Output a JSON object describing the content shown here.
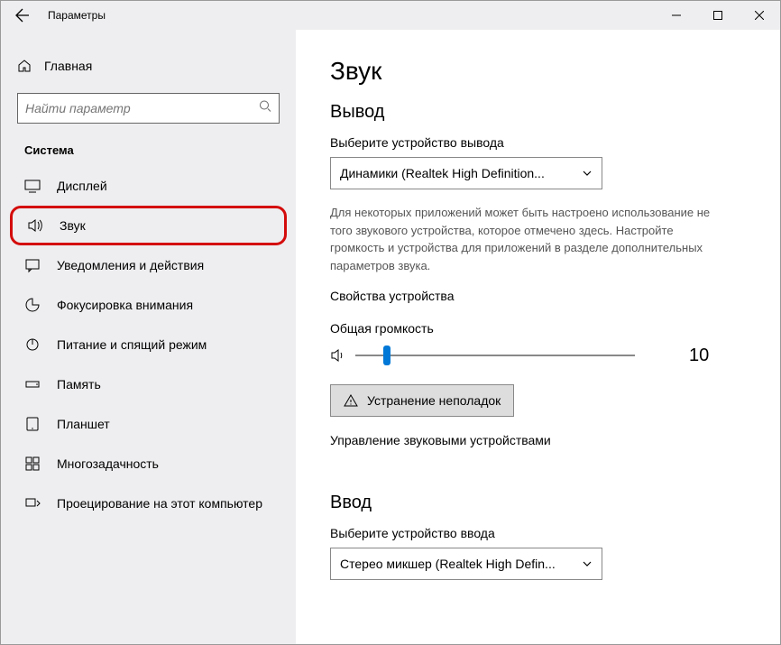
{
  "titlebar": {
    "title": "Параметры"
  },
  "sidebar": {
    "home": "Главная",
    "search_placeholder": "Найти параметр",
    "section": "Система",
    "items": [
      {
        "label": "Дисплей"
      },
      {
        "label": "Звук"
      },
      {
        "label": "Уведомления и действия"
      },
      {
        "label": "Фокусировка внимания"
      },
      {
        "label": "Питание и спящий режим"
      },
      {
        "label": "Память"
      },
      {
        "label": "Планшет"
      },
      {
        "label": "Многозадачность"
      },
      {
        "label": "Проецирование на этот компьютер"
      }
    ]
  },
  "main": {
    "title": "Звук",
    "output": {
      "heading": "Вывод",
      "choose_label": "Выберите устройство вывода",
      "device": "Динамики (Realtek High Definition...",
      "help": "Для некоторых приложений может быть настроено использование не того звукового устройства, которое отмечено здесь. Настройте громкость и устройства для приложений в разделе дополнительных параметров звука.",
      "properties_link": "Свойства устройства",
      "volume_label": "Общая громкость",
      "volume_value": "10",
      "troubleshoot": "Устранение неполадок",
      "manage_link": "Управление звуковыми устройствами"
    },
    "input": {
      "heading": "Ввод",
      "choose_label": "Выберите устройство ввода",
      "device": "Стерео микшер (Realtek High Defin..."
    }
  }
}
